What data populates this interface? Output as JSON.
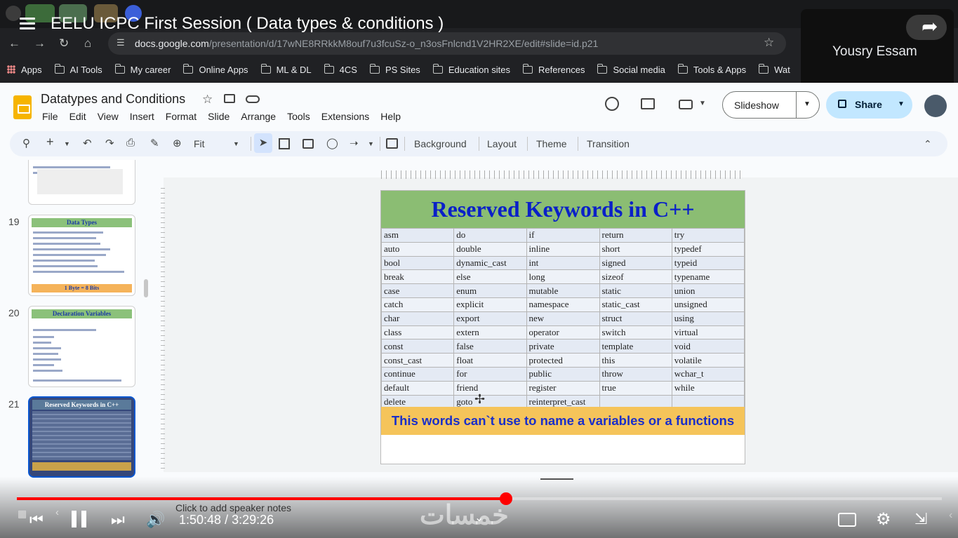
{
  "video": {
    "title": "EELU ICPC First Session ( Data types & conditions )",
    "current_time": "1:50:48",
    "duration": "3:29:26",
    "time_sep": " / ",
    "progress": 0.529,
    "watermark": "خمسات"
  },
  "browser": {
    "url_host": "docs.google.com",
    "url_path": "/presentation/d/17wNE8RRkkM8ouf7u3fcuSz-o_n3osFnlcnd1V2HR2XE/edit#slide=id.p21",
    "bookmarks": [
      "Apps",
      "AI Tools",
      "My career",
      "Online Apps",
      "ML & DL",
      "4CS",
      "PS Sites",
      "Education sites",
      "References",
      "Social media",
      "Tools & Apps",
      "Wat"
    ]
  },
  "popup": {
    "user_name": "Yousry Essam"
  },
  "slides_app": {
    "doc_title": "Datatypes and Conditions",
    "menu": [
      "File",
      "Edit",
      "View",
      "Insert",
      "Format",
      "Slide",
      "Arrange",
      "Tools",
      "Extensions",
      "Help"
    ],
    "slideshow_label": "Slideshow",
    "share_label": "Share",
    "zoom": "Fit",
    "toolbar_text": {
      "background": "Background",
      "layout": "Layout",
      "theme": "Theme",
      "transition": "Transition"
    },
    "speaker_notes_placeholder": "Click to add speaker notes"
  },
  "filmstrip": [
    {
      "number": "19",
      "title": "Data Types",
      "footer": "1 Byte = 8 Bits"
    },
    {
      "number": "20",
      "title": "Declaration Variables"
    },
    {
      "number": "21",
      "title": "Reserved Keywords in C++"
    }
  ],
  "slide": {
    "title": "Reserved Keywords in C++",
    "rows": [
      [
        "asm",
        "do",
        "if",
        "return",
        "try"
      ],
      [
        "auto",
        "double",
        "inline",
        "short",
        "typedef"
      ],
      [
        "bool",
        "dynamic_cast",
        "int",
        "signed",
        "typeid"
      ],
      [
        "break",
        "else",
        "long",
        "sizeof",
        "typename"
      ],
      [
        "case",
        "enum",
        "mutable",
        "static",
        "union"
      ],
      [
        "catch",
        "explicit",
        "namespace",
        "static_cast",
        "unsigned"
      ],
      [
        "char",
        "export",
        "new",
        "struct",
        "using"
      ],
      [
        "class",
        "extern",
        "operator",
        "switch",
        "virtual"
      ],
      [
        "const",
        "false",
        "private",
        "template",
        "void"
      ],
      [
        "const_cast",
        "float",
        "protected",
        "this",
        "volatile"
      ],
      [
        "continue",
        "for",
        "public",
        "throw",
        "wchar_t"
      ],
      [
        "default",
        "friend",
        "register",
        "true",
        "while"
      ],
      [
        "delete",
        "goto",
        "reinterpret_cast",
        "",
        ""
      ]
    ],
    "note": "This words can`t use to name a variables or a functions"
  },
  "colors": {
    "accent_red": "#ff0000",
    "slide_header_green": "#8bbd73",
    "keyword_blue": "#0a20c8",
    "note_yellow": "#f5c45a",
    "share_blue": "#c2e7ff"
  }
}
